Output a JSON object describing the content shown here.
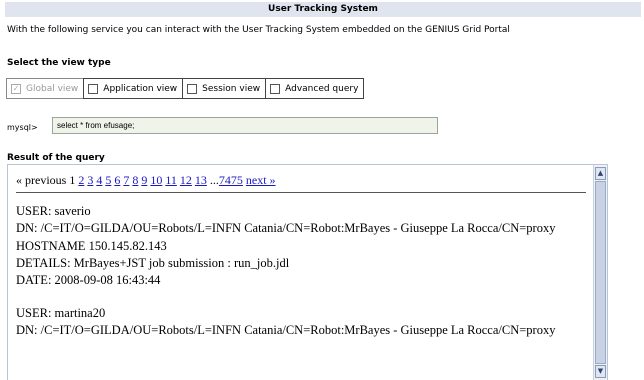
{
  "header": {
    "title": "User Tracking System"
  },
  "intro_text": "With the following service you can interact with the User Tracking System embedded on the GENIUS Grid Portal",
  "view_type": {
    "heading": "Select the view type",
    "options": [
      {
        "label": "Global view",
        "checked": true,
        "disabled": true
      },
      {
        "label": "Application view",
        "checked": false,
        "disabled": false
      },
      {
        "label": "Session view",
        "checked": false,
        "disabled": false
      },
      {
        "label": "Advanced query",
        "checked": false,
        "disabled": false
      }
    ]
  },
  "query": {
    "prompt": "mysql>",
    "value": "select * from efusage;"
  },
  "result": {
    "heading": "Result of the query",
    "pager": {
      "previous": "« previous",
      "current": "1",
      "pages": [
        "2",
        "3",
        "4",
        "5",
        "6",
        "7",
        "8",
        "9",
        "10",
        "11",
        "12",
        "13"
      ],
      "ellipsis": "...",
      "last": "7475",
      "next": "next »"
    },
    "records": [
      {
        "user": "USER: saverio",
        "dn": "DN: /C=IT/O=GILDA/OU=Robots/L=INFN Catania/CN=Robot:MrBayes - Giuseppe La Rocca/CN=proxy",
        "hostname": "HOSTNAME 150.145.82.143",
        "details": "DETAILS: MrBayes+JST job submission : run_job.jdl",
        "date": "DATE: 2008-09-08 16:43:44"
      },
      {
        "user": "USER: martina20",
        "dn": "DN: /C=IT/O=GILDA/OU=Robots/L=INFN Catania/CN=Robot:MrBayes - Giuseppe La Rocca/CN=proxy",
        "hostname": "",
        "details": "",
        "date": ""
      }
    ]
  },
  "icons": {
    "checkbox_checked": "✓",
    "scroll_up": "▲",
    "scroll_down": "▼"
  }
}
